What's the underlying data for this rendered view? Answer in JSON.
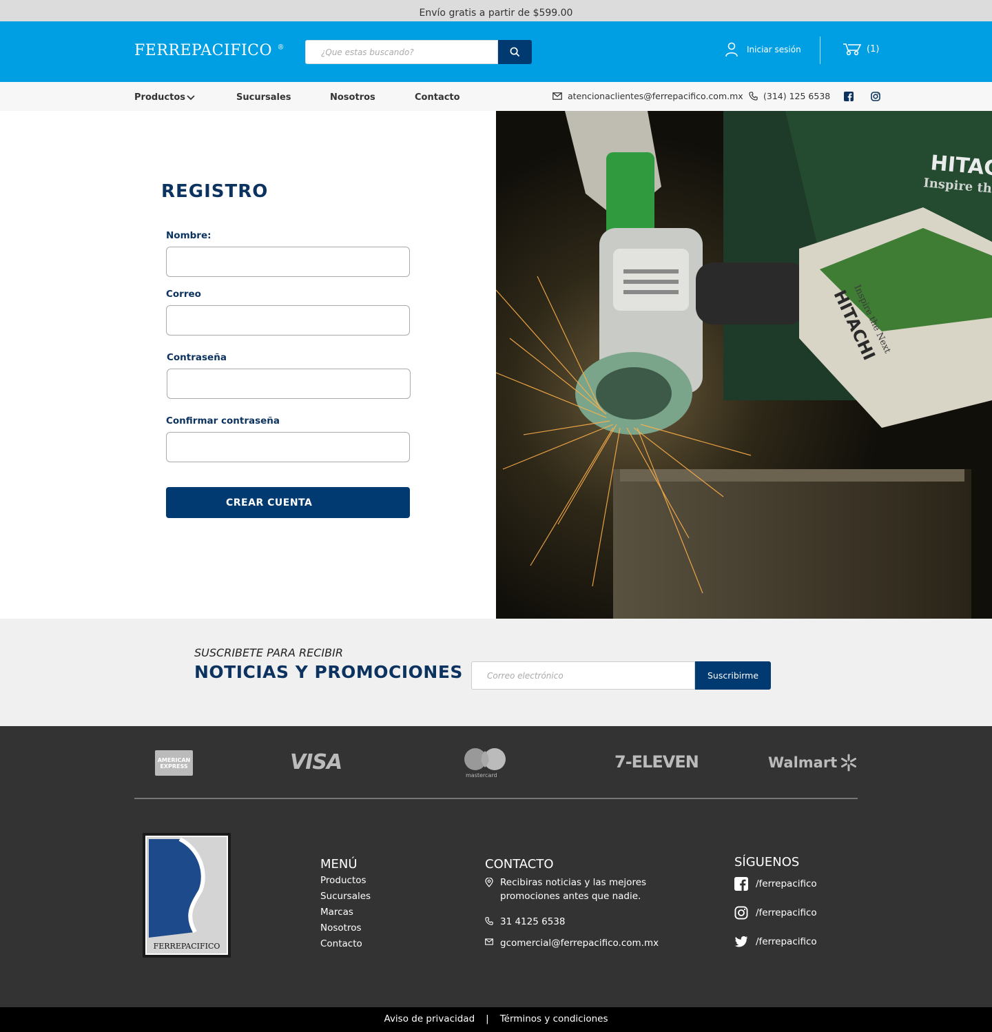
{
  "topbar": {
    "text": "Envío gratis a partir de $599.00"
  },
  "header": {
    "logo": "FERREPACIFICO",
    "logo_mark": "®",
    "search_placeholder": "¿Que estas buscando?",
    "login_label": "Iniciar sesión",
    "cart_count": "(1)"
  },
  "nav": {
    "items": [
      "Productos",
      "Sucursales",
      "Nosotros",
      "Contacto"
    ],
    "email": "atencionaclientes@ferrepacifico.com.mx",
    "phone": "(314) 125 6538"
  },
  "form": {
    "title": "REGISTRO",
    "labels": [
      "Nombre:",
      "Correo",
      "Contraseña",
      "Confirmar contraseña"
    ],
    "values": [
      "",
      "",
      "",
      ""
    ],
    "submit": "CREAR CUENTA"
  },
  "hero": {
    "brand_text": "HITACHI",
    "brand_tagline": "Inspire the Next"
  },
  "newsletter": {
    "subtitle": "SUSCRIBETE PARA RECIBIR",
    "title": "NOTICIAS Y PROMOCIONES",
    "placeholder": "Correo electrónico",
    "button": "Suscribirme"
  },
  "payments": [
    "AMERICAN EXPRESS",
    "VISA",
    "mastercard",
    "7-ELEVEN",
    "Walmart"
  ],
  "footer": {
    "logo_text": "FERREPACIFICO",
    "menu_title": "MENÚ",
    "menu": [
      "Productos",
      "Sucursales",
      "Marcas",
      "Nosotros",
      "Contacto"
    ],
    "contact_title": "CONTACTO",
    "contact_text_1": "Recibiras noticias y las mejores",
    "contact_text_2": "promociones antes que nadie.",
    "contact_phone": "31 4125 6538",
    "contact_email": "gcomercial@ferrepacifico.com.mx",
    "social_title": "SÍGUENOS",
    "social": [
      "/ferrepacifico",
      "/ferrepacifico",
      "/ferrepacifico"
    ]
  },
  "bottom": {
    "privacy": "Aviso de privacidad",
    "separator": "|",
    "terms": "Términos y condiciones"
  },
  "colors": {
    "brand_blue": "#009fe3",
    "navy": "#003a70",
    "title_navy": "#0c3360",
    "footer_bg": "#333333"
  }
}
